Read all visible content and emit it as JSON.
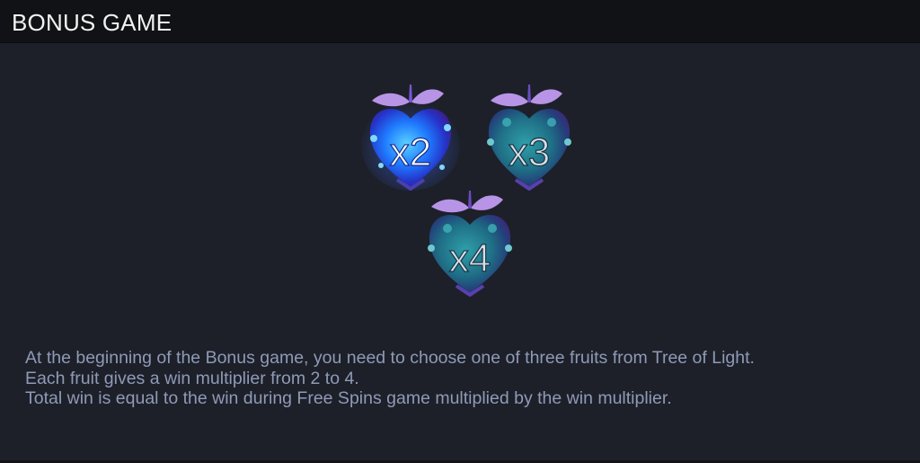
{
  "header": {
    "title": "BONUS GAME"
  },
  "fruits": [
    {
      "label": "x2",
      "state": "highlighted"
    },
    {
      "label": "x3",
      "state": "normal"
    },
    {
      "label": "x4",
      "state": "normal"
    }
  ],
  "description": {
    "lines": [
      "At the beginning of the Bonus game, you need to choose one of three fruits from Tree of Light.",
      "Each fruit gives a win multiplier from 2 to 4.",
      "Total win is equal to the win during Free Spins game multiplied by the win multiplier."
    ]
  },
  "colors": {
    "background": "#1d2029",
    "header_background": "#111216",
    "text": "#8f9ab6",
    "fruit_highlight": "#2a6bff",
    "fruit_teal": "#1f6f86",
    "leaf": "#b894e6"
  }
}
